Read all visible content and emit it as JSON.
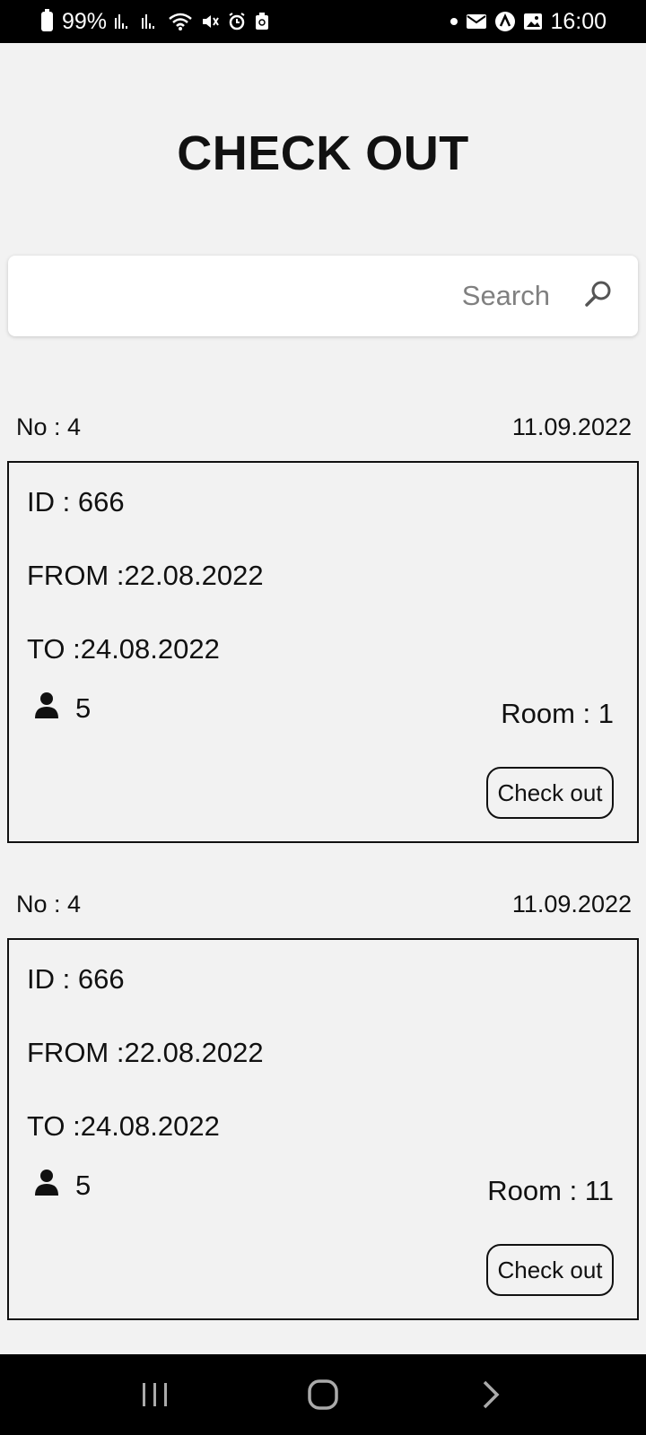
{
  "status_bar": {
    "battery": "99%",
    "time": "16:00",
    "icons_left": [
      "battery-icon",
      "signal-icon",
      "signal-icon",
      "wifi-icon",
      "mute-icon",
      "alarm-icon",
      "recycle-icon"
    ],
    "icons_right": [
      "dot-icon",
      "mail-icon",
      "app-icon",
      "image-icon"
    ]
  },
  "page": {
    "title": "CHECK OUT"
  },
  "search": {
    "placeholder": "Search",
    "value": ""
  },
  "bookings": [
    {
      "no": "No : 4",
      "date": "11.09.2022",
      "id": "ID : 666",
      "from": "FROM :22.08.2022",
      "to": "TO :24.08.2022",
      "guests": "5",
      "room": "Room : 1",
      "button": "Check out"
    },
    {
      "no": "No : 4",
      "date": "11.09.2022",
      "id": "ID : 666",
      "from": "FROM :22.08.2022",
      "to": "TO :24.08.2022",
      "guests": "5",
      "room": "Room : 11",
      "button": "Check out"
    }
  ],
  "nav_bar": {
    "icons": [
      "recent-apps-icon",
      "home-icon",
      "back-icon"
    ]
  }
}
